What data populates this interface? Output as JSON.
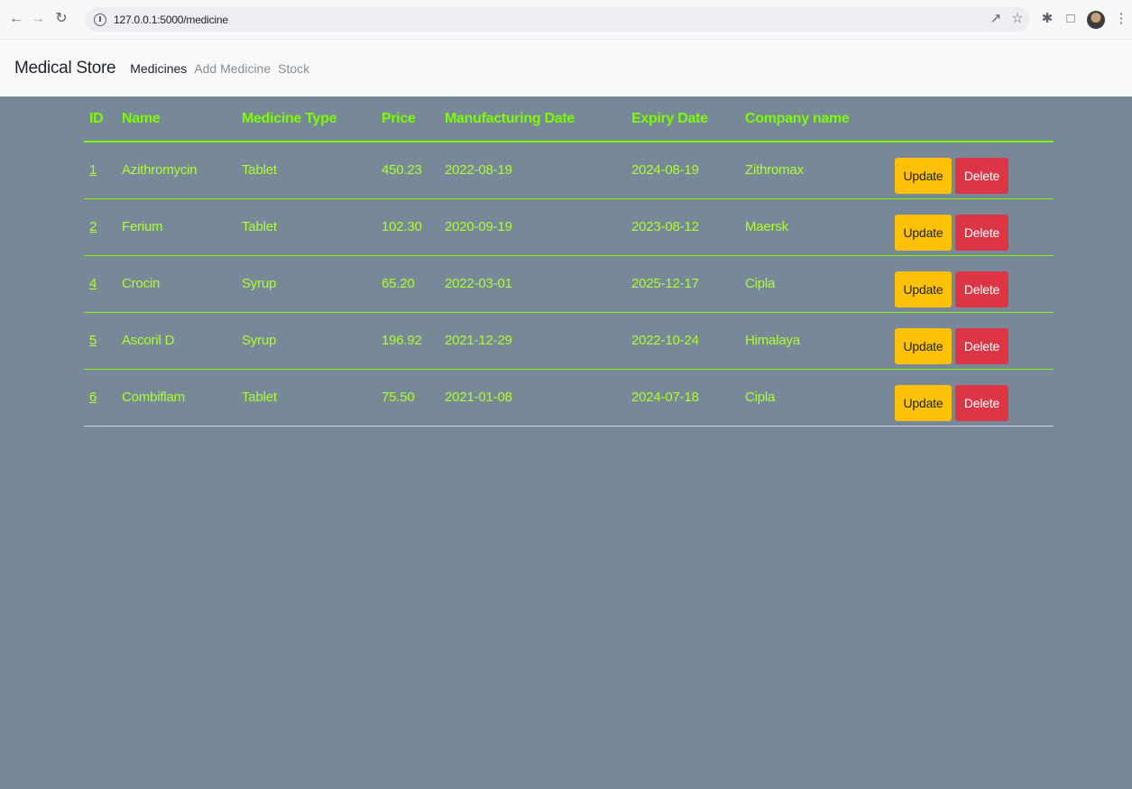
{
  "browser": {
    "url": "127.0.0.1:5000/medicine",
    "icons": [
      "back-arrow-icon",
      "forward-arrow-icon",
      "reload-icon",
      "site-info-icon",
      "share-icon",
      "bookmark-star-icon",
      "extensions-puzzle-icon",
      "side-panel-icon",
      "profile-avatar",
      "menu-kebab-icon"
    ]
  },
  "navbar": {
    "brand": "Medical Store",
    "links": [
      {
        "label": "Medicines",
        "active": true
      },
      {
        "label": "Add Medicine",
        "active": false
      },
      {
        "label": "Stock",
        "active": false
      }
    ]
  },
  "table": {
    "headers": [
      "ID",
      "Name",
      "Medicine Type",
      "Price",
      "Manufacturing Date",
      "Expiry Date",
      "Company name"
    ],
    "rows": [
      {
        "id": "1",
        "name": "Azithromycin",
        "type": "Tablet",
        "price": "450.23",
        "mfg": "2022-08-19",
        "expiry": "2024-08-19",
        "company": "Zithromax"
      },
      {
        "id": "2",
        "name": "Ferium",
        "type": "Tablet",
        "price": "102.30",
        "mfg": "2020-09-19",
        "expiry": "2023-08-12",
        "company": "Maersk"
      },
      {
        "id": "4",
        "name": "Crocin",
        "type": "Syrup",
        "price": "65.20",
        "mfg": "2022-03-01",
        "expiry": "2025-12-17",
        "company": "Cipla"
      },
      {
        "id": "5",
        "name": "Ascoril D",
        "type": "Syrup",
        "price": "196.92",
        "mfg": "2021-12-29",
        "expiry": "2022-10-24",
        "company": "Himalaya"
      },
      {
        "id": "6",
        "name": "Combiflam",
        "type": "Tablet",
        "price": "75.50",
        "mfg": "2021-01-08",
        "expiry": "2024-07-18",
        "company": "Cipla"
      }
    ],
    "update_label": "Update",
    "delete_label": "Delete"
  },
  "colors": {
    "page_bg": "#778899",
    "header_text": "#7cfc00",
    "cell_text": "#adff2f",
    "update_btn": "#ffc107",
    "delete_btn": "#dc3545"
  }
}
